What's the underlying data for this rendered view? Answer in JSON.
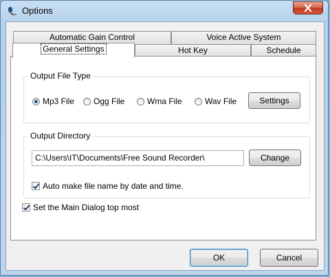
{
  "window": {
    "title": "Options"
  },
  "tabs": {
    "row1": [
      "Automatic Gain Control",
      "Voice Active System"
    ],
    "row2": [
      "General Settings",
      "Hot Key",
      "Schedule"
    ]
  },
  "output_file_type": {
    "label": "Output File Type",
    "options": [
      "Mp3 File",
      "Ogg File",
      "Wma File",
      "Wav File"
    ],
    "selected": "Mp3 File",
    "settings_button": "Settings"
  },
  "output_directory": {
    "label": "Output Directory",
    "path": "C:\\Users\\IT\\Documents\\Free Sound Recorder\\",
    "change_button": "Change",
    "auto_name_label": "Auto make file name by date and time.",
    "auto_name_checked": true
  },
  "topmost": {
    "label": "Set the Main Dialog top most",
    "checked": true
  },
  "footer": {
    "ok_label": "OK",
    "cancel_label": "Cancel"
  },
  "colors": {
    "titlebar": "#b7d2ec",
    "close_button": "#c2361b",
    "radio_dot": "#1e4f8c"
  }
}
